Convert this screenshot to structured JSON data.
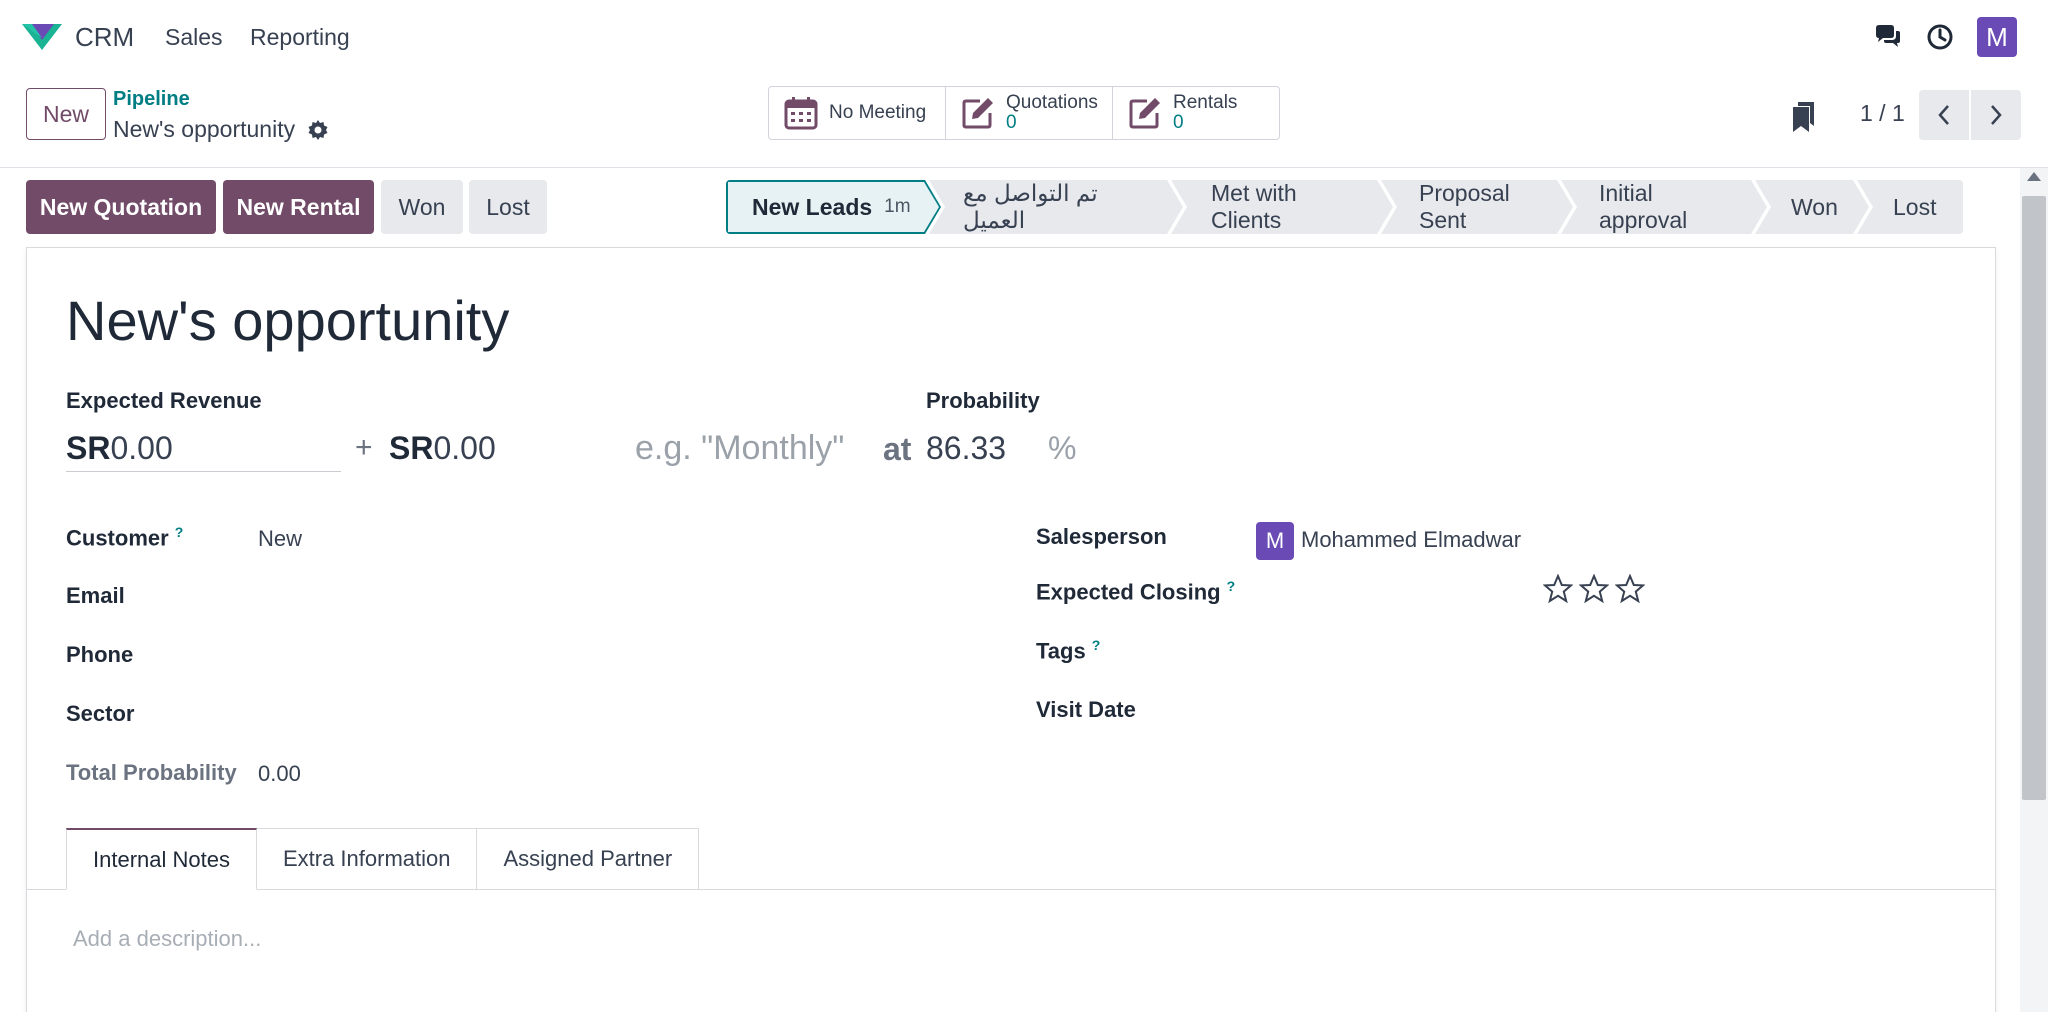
{
  "navbar": {
    "app_name": "CRM",
    "menu": [
      "Sales",
      "Reporting"
    ],
    "avatar_letter": "M",
    "icons": [
      "crm-logo-icon",
      "chat-icon",
      "clock-icon"
    ]
  },
  "control_panel": {
    "new_button": "New",
    "breadcrumb_parent": "Pipeline",
    "breadcrumb_current": "New's opportunity",
    "smart_buttons": {
      "meeting": {
        "label": "No Meeting"
      },
      "quotations": {
        "label": "Quotations",
        "count": "0"
      },
      "rentals": {
        "label": "Rentals",
        "count": "0"
      }
    },
    "pager": "1 / 1"
  },
  "actions": {
    "new_quotation": "New Quotation",
    "new_rental": "New Rental",
    "won": "Won",
    "lost": "Lost"
  },
  "stages": [
    {
      "label": "New Leads",
      "sub": "1m",
      "active": true
    },
    {
      "label": "تم التواصل مع العميل"
    },
    {
      "label": "Met with Clients"
    },
    {
      "label": "Proposal Sent"
    },
    {
      "label": "Initial approval"
    },
    {
      "label": "Won"
    },
    {
      "label": "Lost"
    }
  ],
  "form": {
    "title": "New's opportunity",
    "expected_revenue_label": "Expected Revenue",
    "currency": "SR",
    "expected_revenue": "0.00",
    "recurring_revenue": "0.00",
    "plus": "+",
    "recurring_plan_placeholder": "e.g. \"Monthly\"",
    "at": "at",
    "probability_label": "Probability",
    "probability": "86.33",
    "percent": "%",
    "left_fields": [
      {
        "label": "Customer",
        "help": "?",
        "value": "New"
      },
      {
        "label": "Email",
        "value": ""
      },
      {
        "label": "Phone",
        "value": ""
      },
      {
        "label": "Sector",
        "value": ""
      },
      {
        "label": "Total Probability",
        "value": "0.00"
      }
    ],
    "right_fields": [
      {
        "label": "Salesperson",
        "value": "Mohammed Elmadwar",
        "avatar": "M"
      },
      {
        "label": "Expected Closing",
        "help": "?",
        "value": ""
      },
      {
        "label": "Tags",
        "help": "?",
        "value": ""
      },
      {
        "label": "Visit Date",
        "value": ""
      }
    ],
    "priority_stars": 0,
    "priority_max": 3,
    "tabs": [
      "Internal Notes",
      "Extra Information",
      "Assigned Partner"
    ],
    "description_placeholder": "Add a description..."
  },
  "colors": {
    "brand": "#714b67",
    "teal": "#017e84",
    "avatar": "#6a4bb5"
  }
}
